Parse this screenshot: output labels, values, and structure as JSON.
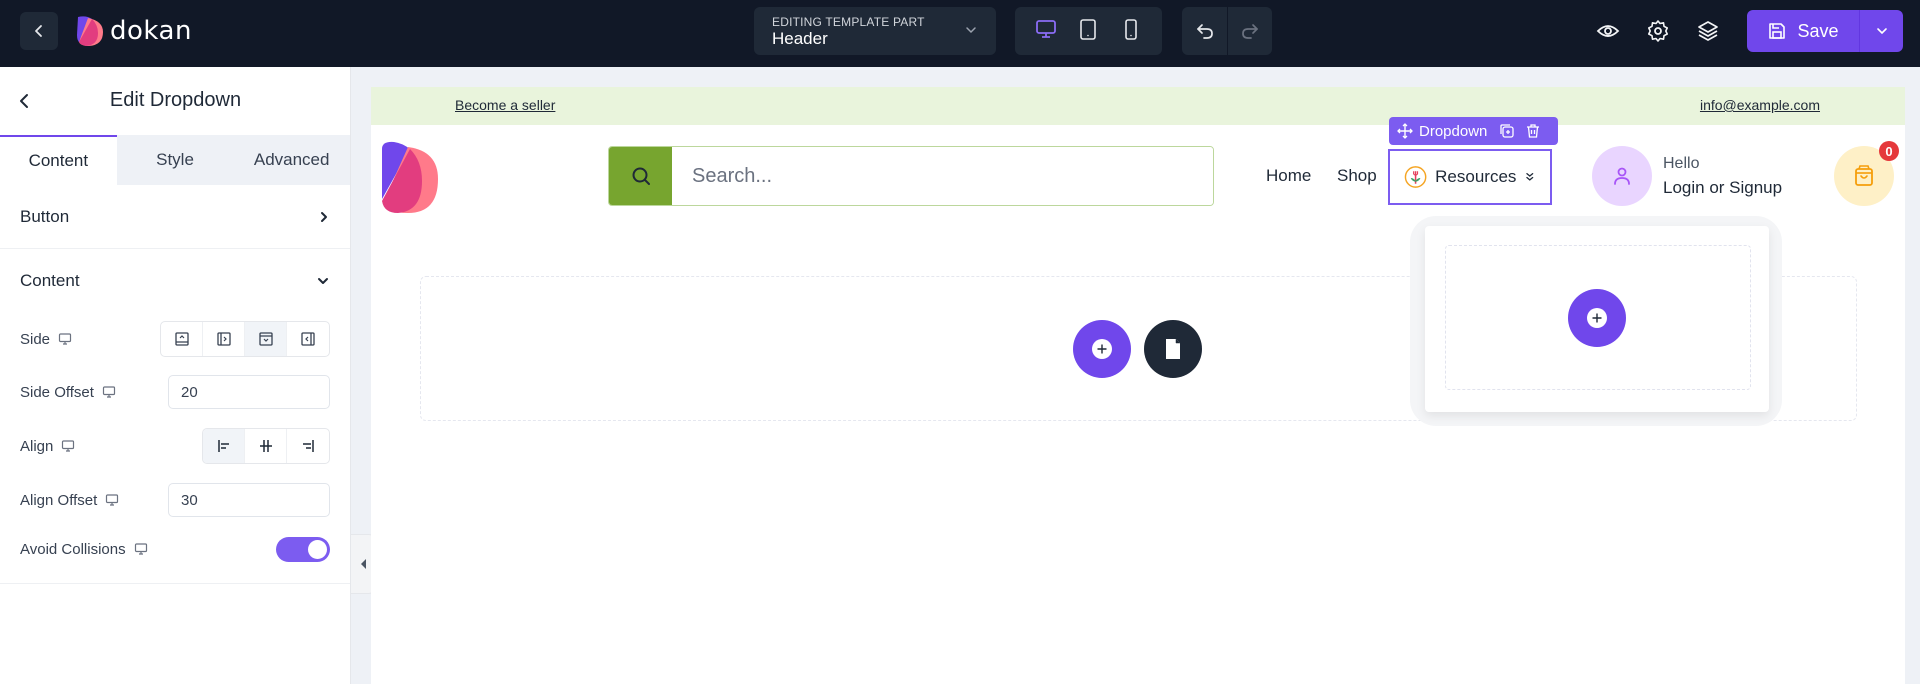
{
  "topbar": {
    "brand": "dokan",
    "template_label": "EDITING TEMPLATE PART",
    "template_value": "Header",
    "devices": [
      {
        "name": "desktop",
        "active": true
      },
      {
        "name": "tablet",
        "active": false
      },
      {
        "name": "mobile",
        "active": false
      }
    ],
    "save_label": "Save",
    "accent_color": "#7047eb"
  },
  "panel": {
    "title": "Edit Dropdown",
    "tabs": [
      {
        "label": "Content",
        "active": true
      },
      {
        "label": "Style",
        "active": false
      },
      {
        "label": "Advanced",
        "active": false
      }
    ],
    "sections": {
      "button": {
        "label": "Button"
      },
      "content": {
        "label": "Content",
        "side": {
          "label": "Side",
          "options": [
            "top",
            "right",
            "bottom",
            "left"
          ],
          "selected": "bottom"
        },
        "side_offset": {
          "label": "Side Offset",
          "value": "20"
        },
        "align": {
          "label": "Align",
          "options": [
            "start",
            "center",
            "end"
          ],
          "selected": "start"
        },
        "align_offset": {
          "label": "Align Offset",
          "value": "30"
        },
        "avoid_collisions": {
          "label": "Avoid Collisions",
          "value": true
        }
      }
    }
  },
  "canvas": {
    "topstrip": {
      "left_link": "Become a seller",
      "right_link": "info@example.com",
      "bg_color": "#e9f4dc"
    },
    "search": {
      "placeholder": "Search...",
      "button_color": "#77a52f"
    },
    "nav": [
      "Home",
      "Shop"
    ],
    "dropdown": {
      "toolbar_label": "Dropdown",
      "item_label": "Resources"
    },
    "account": {
      "greeting": "Hello",
      "action": "Login or Signup"
    },
    "cart": {
      "count": "0"
    }
  }
}
